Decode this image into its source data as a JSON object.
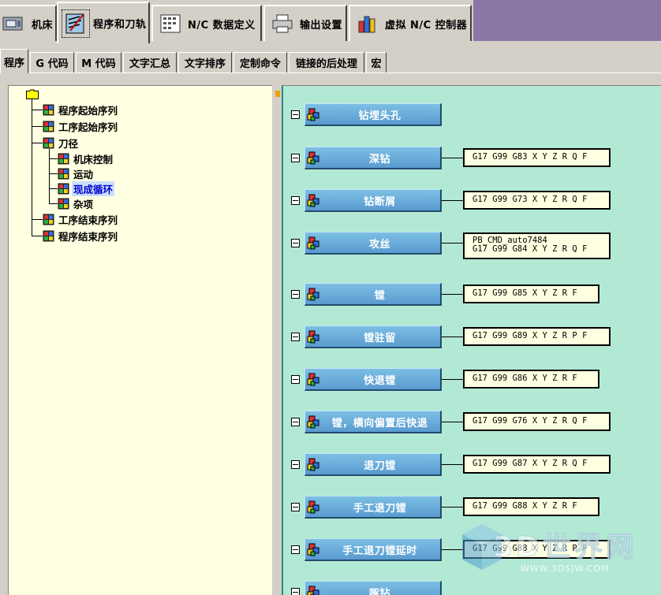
{
  "top_tabs": [
    {
      "label": "机床",
      "icon": "machine-icon"
    },
    {
      "label": "程序和刀轨",
      "icon": "program-toolpath-icon",
      "active": true
    },
    {
      "label": "N/C 数据定义",
      "icon": "nc-data-icon"
    },
    {
      "label": "输出设置",
      "icon": "printer-icon"
    },
    {
      "label": "虚拟 N/C 控制器",
      "icon": "controller-icon"
    }
  ],
  "sub_tabs": [
    {
      "label": "程序",
      "active": true
    },
    {
      "label": "G 代码"
    },
    {
      "label": "M 代码"
    },
    {
      "label": "文字汇总"
    },
    {
      "label": "文字排序"
    },
    {
      "label": "定制命令"
    },
    {
      "label": "链接的后处理"
    },
    {
      "label": "宏"
    }
  ],
  "tree": {
    "items": [
      {
        "label": "程序起始序列"
      },
      {
        "label": "工序起始序列"
      },
      {
        "label": "刀径"
      },
      {
        "label": "机床控制"
      },
      {
        "label": "运动"
      },
      {
        "label": "现成循环",
        "selected": true
      },
      {
        "label": "杂项"
      },
      {
        "label": "工序结束序列"
      },
      {
        "label": "程序结束序列"
      }
    ]
  },
  "cycles": [
    {
      "name": "钻埋头孔",
      "command": ""
    },
    {
      "name": "深钻",
      "command": "G17 G99 G83 X Y Z R Q F"
    },
    {
      "name": "钻断屑",
      "command": "G17 G99 G73 X Y Z R Q F"
    },
    {
      "name": "攻丝",
      "command": "PB_CMD_auto7484\nG17 G99 G84 X Y Z R Q F"
    },
    {
      "name": "镗",
      "command": "G17 G99 G85 X Y Z R F"
    },
    {
      "name": "镗驻留",
      "command": "G17 G99 G89 X Y Z R P F"
    },
    {
      "name": "快退镗",
      "command": "G17 G99 G86 X Y Z R F"
    },
    {
      "name": "镗，横向偏置后快退",
      "command": "G17 G99 G76 X Y Z R Q F"
    },
    {
      "name": "退刀镗",
      "command": "G17 G99 G87 X Y Z R Q F"
    },
    {
      "name": "手工退刀镗",
      "command": "G17 G99 G88 X Y Z R F"
    },
    {
      "name": "手工退刀镗延时",
      "command": "G17 G99 G88 X Y Z R P F"
    },
    {
      "name": "啄钻",
      "command": ""
    }
  ],
  "watermark": {
    "text": "3D世界网",
    "url": "WWW.3DSJW.COM"
  },
  "colors": {
    "flow_background": "#b2e9d4",
    "tree_background": "#ffffe1",
    "button_blue": "#5a9bd0",
    "header_purple": "#8b76a6"
  }
}
